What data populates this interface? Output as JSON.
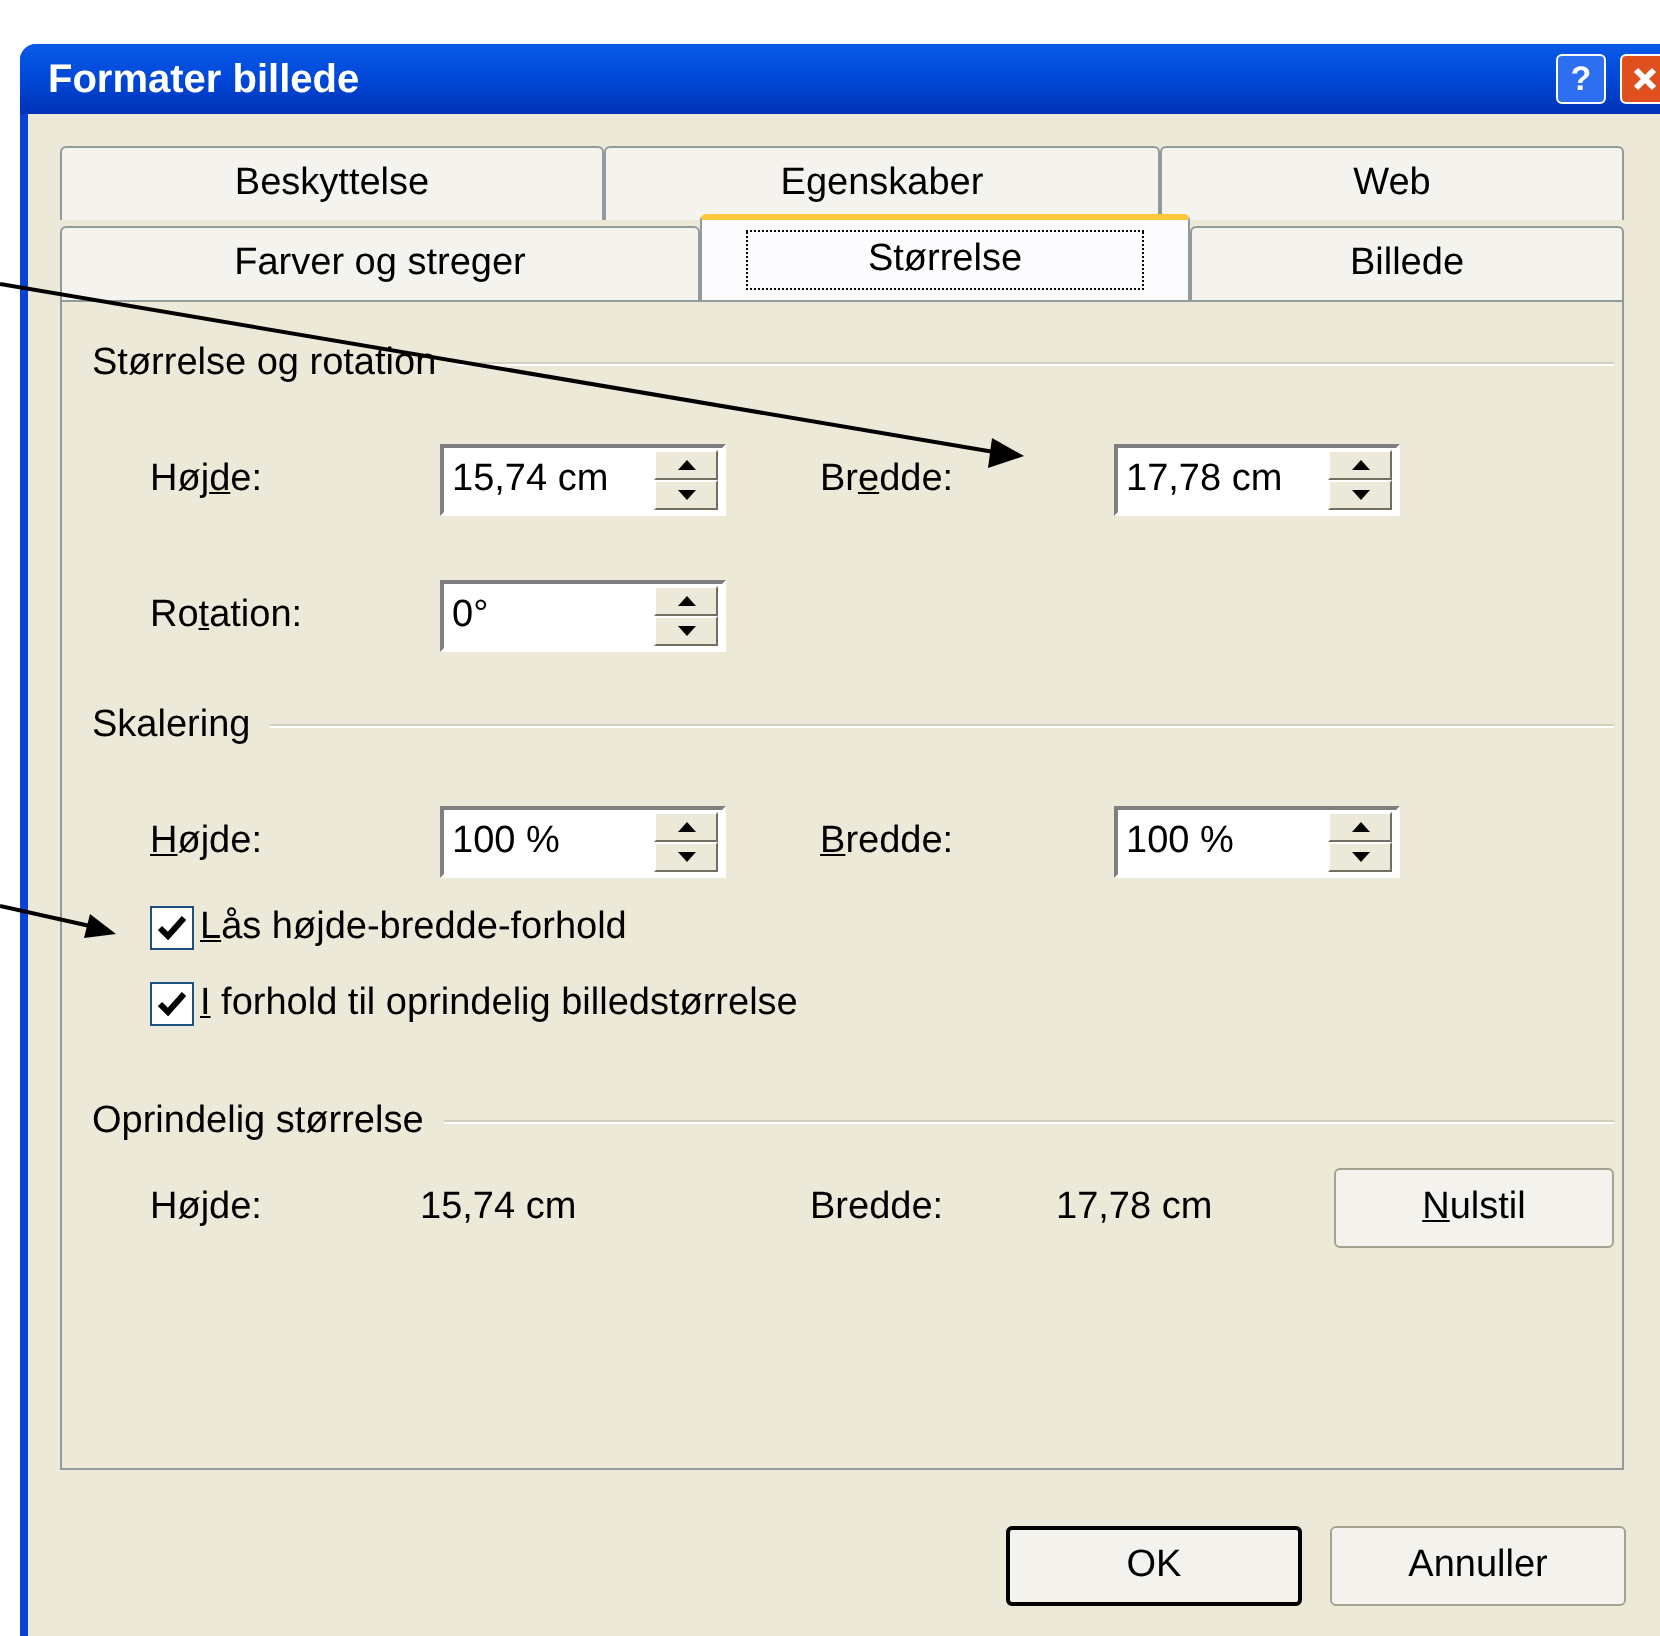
{
  "window": {
    "title": "Formater billede",
    "help": "?"
  },
  "tab_rows": [
    [
      {
        "label": "Beskyttelse",
        "selected": false
      },
      {
        "label": "Egenskaber",
        "selected": false
      },
      {
        "label": "Web",
        "selected": false
      }
    ],
    [
      {
        "label": "Farver og streger",
        "selected": false
      },
      {
        "label": "Størrelse",
        "selected": true
      },
      {
        "label": "Billede",
        "selected": false
      }
    ]
  ],
  "sections": [
    {
      "title": "Størrelse og rotation",
      "items": [
        {
          "kind": "spinners",
          "fields": [
            {
              "label": {
                "pre": "Høj",
                "key": "d",
                "post": "e:"
              },
              "value": "15,74 cm"
            },
            {
              "label": {
                "pre": "Br",
                "key": "e",
                "post": "dde:"
              },
              "value": "17,78 cm"
            }
          ]
        },
        {
          "kind": "spinners",
          "fields": [
            {
              "label": {
                "pre": "Ro",
                "key": "t",
                "post": "ation:"
              },
              "value": "0°"
            }
          ]
        }
      ]
    },
    {
      "title": "Skalering",
      "items": [
        {
          "kind": "spinners",
          "fields": [
            {
              "label": {
                "key": "H",
                "post": "øjde:"
              },
              "value": "100 %"
            },
            {
              "label": {
                "key": "B",
                "post": "redde:"
              },
              "value": "100 %"
            }
          ]
        },
        {
          "kind": "checkbox",
          "label": {
            "key": "L",
            "post": "ås højde-bredde-forhold"
          },
          "checked": true
        },
        {
          "kind": "checkbox",
          "label": {
            "key": "I",
            "post": " forhold til oprindelig billedstørrelse"
          },
          "checked": true
        }
      ]
    },
    {
      "title": "Oprindelig størrelse",
      "items": [
        {
          "kind": "readout",
          "fields": [
            {
              "label": "Højde:",
              "value": "15,74 cm"
            },
            {
              "label": "Bredde:",
              "value": "17,78 cm"
            }
          ],
          "button": {
            "key": "N",
            "post": "ulstil"
          }
        }
      ]
    }
  ],
  "buttons": [
    "OK",
    "Annuller"
  ]
}
